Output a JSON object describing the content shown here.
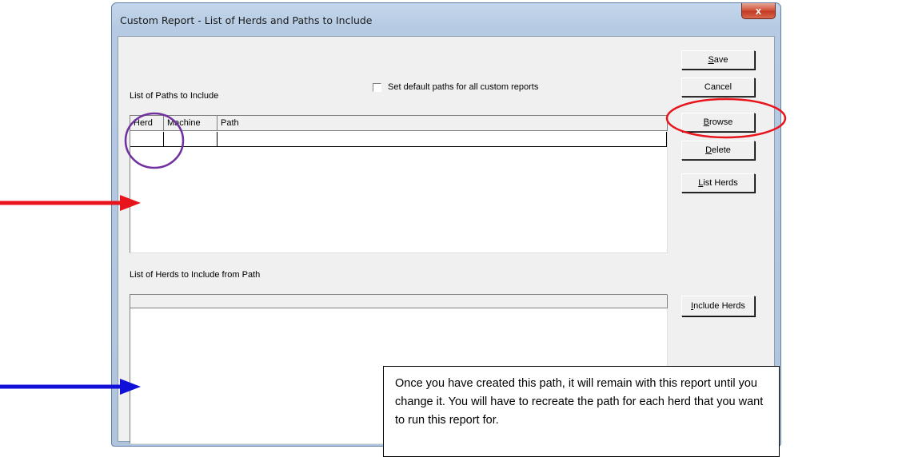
{
  "window": {
    "title": "Custom Report - List of Herds and Paths to Include",
    "close_symbol": "x"
  },
  "paths_section": {
    "label": "List of Paths to Include",
    "default_checkbox_label": "Set default paths for all custom reports",
    "default_checkbox_checked": false,
    "columns": [
      "Herd",
      "Machine",
      "Path"
    ]
  },
  "herds_section": {
    "label": "List of Herds to Include from Path"
  },
  "buttons": {
    "save": "Save",
    "cancel": "Cancel",
    "browse": "Browse",
    "delete": "Delete",
    "list_herds": "List Herds",
    "include_herds": "Include Herds"
  },
  "callout": {
    "text": "Once you have created this path, it will remain with this report until you change it. You will have to recreate the path for each herd that you want to run this report for."
  },
  "annotation_colors": {
    "red": "#e8141c",
    "blue": "#1010d8",
    "purple": "#7030a0"
  }
}
